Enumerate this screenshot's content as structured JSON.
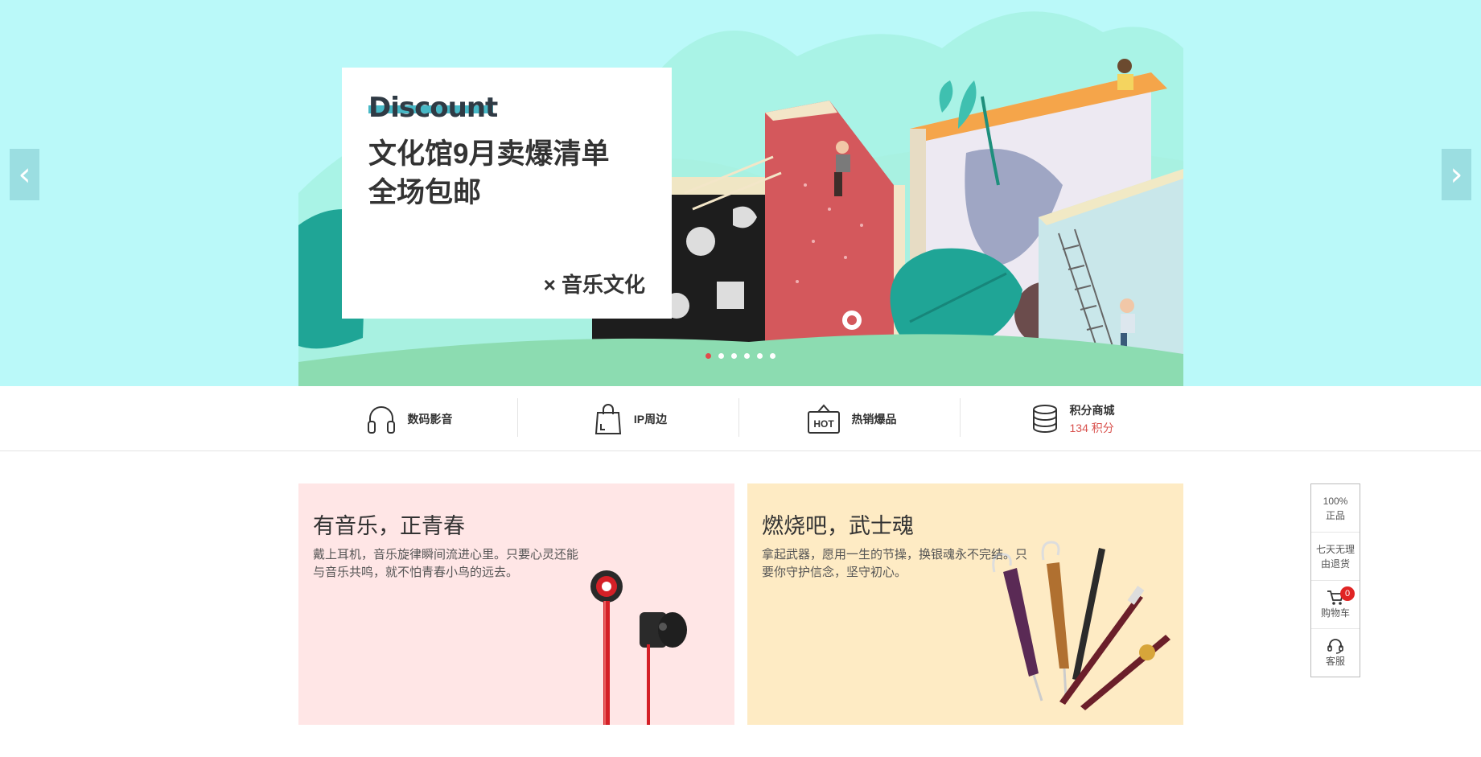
{
  "banner": {
    "eyebrow": "Discount",
    "title_line1": "文化馆9月卖爆清单",
    "title_line2": "全场包邮",
    "tag": "× 音乐文化",
    "prev_arrow": "‹",
    "next_arrow": "›",
    "slide_count": 6,
    "active_slide": 1
  },
  "categories": [
    {
      "label": "数码影音",
      "icon": "headphones-icon"
    },
    {
      "label": "IP周边",
      "icon": "shopping-bag-icon"
    },
    {
      "label": "热销爆品",
      "icon": "hot-sign-icon",
      "icon_text": "HOT"
    },
    {
      "label": "积分商城",
      "sub": "134 积分",
      "icon": "coin-stack-icon"
    }
  ],
  "cards": [
    {
      "title": "有音乐，正青春",
      "desc": "戴上耳机，音乐旋律瞬间流进心里。只要心灵还能与音乐共鸣，就不怕青春小鸟的远去。",
      "bg": "#ffe6e6",
      "icon": "earphones-image"
    },
    {
      "title": "燃烧吧，武士魂",
      "desc": "拿起武器，愿用一生的节操，换银魂永不完结。只要你守护信念，坚守初心。",
      "bg": "#feebc4",
      "icon": "umbrella-katana-image"
    }
  ],
  "sidetool": {
    "genuine_line1": "100%",
    "genuine_line2": "正品",
    "return_line1": "七天无理",
    "return_line2": "由退货",
    "cart_label": "购物车",
    "cart_count": "0",
    "service_label": "客服"
  },
  "colors": {
    "banner_bg": "#baf9f9",
    "accent_red": "#e24b4b",
    "points_red": "#d9534f"
  }
}
